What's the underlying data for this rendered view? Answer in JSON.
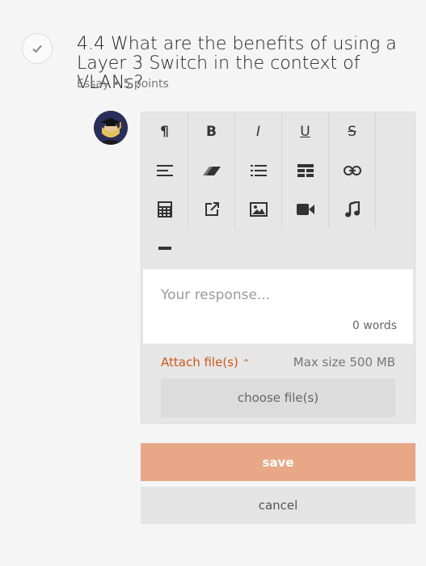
{
  "question": {
    "title": "4.4 What are the benefits of using a Layer 3 Switch in the context of VLANs?",
    "meta": "Essay • 5 points"
  },
  "toolbar": {
    "buttons": [
      {
        "name": "paragraph-icon",
        "glyph": "¶"
      },
      {
        "name": "bold-icon",
        "glyph": "B"
      },
      {
        "name": "italic-icon",
        "glyph": "I"
      },
      {
        "name": "underline-icon",
        "glyph": "U"
      },
      {
        "name": "strikethrough-icon",
        "glyph": "S"
      },
      {
        "name": "align-icon",
        "glyph": "≡"
      },
      {
        "name": "eraser-icon",
        "glyph": "⌫"
      },
      {
        "name": "list-icon",
        "glyph": "☰"
      },
      {
        "name": "table-icon",
        "glyph": "▦"
      },
      {
        "name": "link-icon",
        "glyph": "⛓"
      },
      {
        "name": "calculator-icon",
        "glyph": "▤"
      },
      {
        "name": "external-link-icon",
        "glyph": "↗"
      },
      {
        "name": "image-icon",
        "glyph": "🖼"
      },
      {
        "name": "video-icon",
        "glyph": "■"
      },
      {
        "name": "music-icon",
        "glyph": "♫"
      },
      {
        "name": "horizontal-rule-icon",
        "glyph": "—"
      }
    ]
  },
  "response": {
    "placeholder": "Your response...",
    "word_count": "0 words"
  },
  "attachments": {
    "label": "Attach file(s)",
    "max_size": "Max size 500 MB",
    "choose_button": "choose file(s)"
  },
  "actions": {
    "save": "save",
    "cancel": "cancel"
  },
  "colors": {
    "accent": "#cc5a1a",
    "save_bg": "#e8a888"
  }
}
